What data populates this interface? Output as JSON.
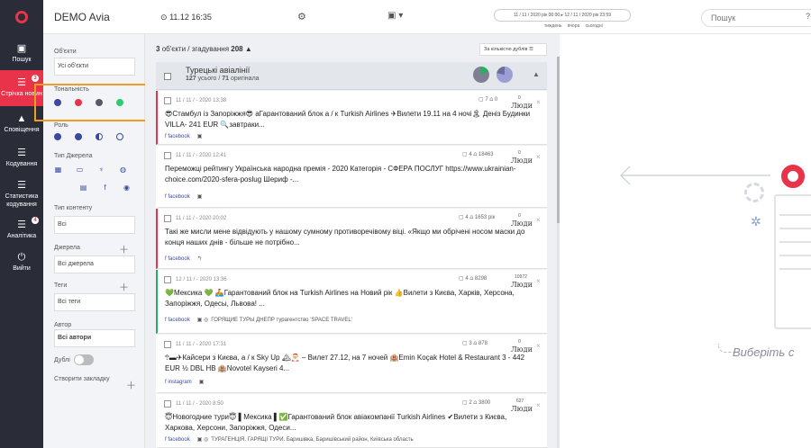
{
  "nav": {
    "items": [
      {
        "icon": "search-icon",
        "label": "Пошук",
        "badge": ""
      },
      {
        "icon": "list-icon",
        "label": "Стрічка новин",
        "badge": "3"
      },
      {
        "icon": "bell-icon",
        "label": "Сповіщення",
        "badge": ""
      },
      {
        "icon": "list-icon",
        "label": "Кодування",
        "badge": ""
      },
      {
        "icon": "list-icon",
        "label": "Статистика кодування",
        "badge": ""
      },
      {
        "icon": "chart-icon",
        "label": "Аналітика",
        "badge": "4"
      },
      {
        "icon": "logout-icon",
        "label": "Вийти",
        "badge": ""
      }
    ]
  },
  "topbar": {
    "title": "DEMO Avia",
    "datetime": "11.12 16:35",
    "range": "11 / 11 / 2020 рік 00:00 ▸ 12 / 11 / 2020 рік 23:59",
    "range_links": "тиждень вчора сьогодні",
    "search_placeholder": "Пошук",
    "help": "?"
  },
  "filters": {
    "objects_label": "Об'єкти",
    "objects_value": "Усі об'єкти",
    "tonality_label": "Тональність",
    "tonality_colors": [
      "#3a4aa0",
      "#e8334a",
      "#555a66",
      "#2ecc71"
    ],
    "role_label": "Роль",
    "source_type_label": "Тип Джерела",
    "content_type_label": "Тип контенту",
    "content_type_value": "Всі",
    "sources_label": "Джерела",
    "sources_value": "Всі джерела",
    "tags_label": "Теги",
    "tags_value": "Всі теги",
    "author_label": "Автор",
    "author_value": "Всі автори",
    "duplicates_label": "Дублі",
    "bookmark_label": "Створити закладку"
  },
  "feed": {
    "count": "3",
    "count_label": "об'єкти / згадування",
    "mentions": "208",
    "sort_label": "За кількістю дублів",
    "group_title": "Турецькі авіалінії",
    "group_sub_total": "127",
    "group_sub_total_label": "усього /",
    "group_sub_orig": "71",
    "group_sub_orig_label": "оригінала",
    "cards": [
      {
        "meta": "11 / 11 / - 2020 13:38",
        "stats": "▢ 7  ⩍ 0",
        "people_num": "0",
        "people": "Люди",
        "text": "😎Стамбул із Запоріжжя😎 аГарантований блок а / к Turkish Airlines ✈Вилети 19.11 на 4 ночі🏝 Деніз Будинки VILLA- 241 EUR 🔍завтраки...",
        "source": "facebook",
        "extra": ""
      },
      {
        "meta": "11 / 11 / - 2020 12:41",
        "stats": "▢ 4  ⩍ 18463",
        "people_num": "0",
        "people": "Люди",
        "text": "Переможці рейтингу Українська народна премія - 2020 Категорія - СФЕРА ПОСЛУГ https://www.ukrainian-choice.com/2020-sfera-poslug Шериф -...",
        "source": "facebook",
        "extra": ""
      },
      {
        "meta": "11 / 11 / - 2020 20:02",
        "stats": "▢ 4  ⩍ 1653 рік",
        "people_num": "0",
        "people": "Люди",
        "text": "Такі же мисли мене відвідують у нашому сумному противоречівому віці. «Якщо ми обрічені носом маски до конця наших днів - більше не потрібно...",
        "source": "facebook",
        "extra": ""
      },
      {
        "meta": "12 / 11 / - 2020 13:36",
        "stats": "▢ 4  ⩍ 8298",
        "people_num": "10972",
        "people": "Люди",
        "text": "💚Мексика 💚 🚣Гарантований блок на Turkish Airlines на Новий рік 👍Вилети з Києва, Харків, Херсона, Запоріжжя, Одесы, Львова! ...",
        "source": "facebook",
        "extra": "ГОРЯЩИЕ ТУРЫ ДНЕПР турагентство 'SPACE TRAVEL'"
      },
      {
        "meta": "11 / 11 / - 2020 17:31",
        "stats": "▢ 3  ⩍ 878",
        "people_num": "0",
        "people": "Люди",
        "text": "🕆▬✈Кайсери з Києва, а / к Sky Up 🏔🎅 – Вилет 27.12, на 7 ночей 🏨Emin Koçak Hotel & Restaurant 3 - 442 EUR ½ DBL HB 🏨Novotel Kayseri 4...",
        "source": "instagram",
        "extra": ""
      },
      {
        "meta": "11 / 11 / - 2020 8:50",
        "stats": "▢ 2  ⩍ 3800",
        "people_num": "627",
        "people": "Люди",
        "text": "😇Новогодние тури😇 ▌Мексика ▌✅Гарантований блок авіакомпанії Turkish Airlines ✔Вилети з Києва, Харкова, Херсони, Запоріжжя, Одеси...",
        "source": "facebook",
        "extra": "ТУРАГЕНЦІЯ. ГАРЯЩІ ТУРИ. Баришівка, Баришівський район, Київська область"
      }
    ]
  },
  "empty": {
    "choose_text": "Виберіть с"
  }
}
